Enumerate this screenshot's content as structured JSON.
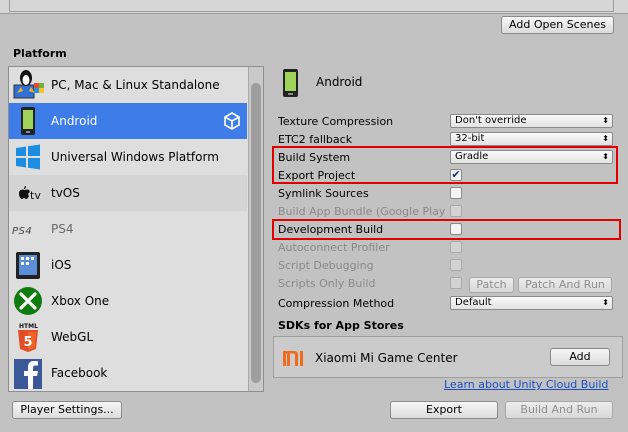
{
  "header": {
    "add_open_scenes": "Add Open Scenes"
  },
  "platform_header": "Platform",
  "platforms": [
    {
      "label": "PC, Mac & Linux Standalone"
    },
    {
      "label": "Android"
    },
    {
      "label": "Universal Windows Platform"
    },
    {
      "label": "tvOS"
    },
    {
      "label": "PS4"
    },
    {
      "label": "iOS"
    },
    {
      "label": "Xbox One"
    },
    {
      "label": "WebGL"
    },
    {
      "label": "Facebook"
    }
  ],
  "settings": {
    "title": "Android",
    "texture_compression": {
      "label": "Texture Compression",
      "value": "Don't override"
    },
    "etc2_fallback": {
      "label": "ETC2 fallback",
      "value": "32-bit"
    },
    "build_system": {
      "label": "Build System",
      "value": "Gradle"
    },
    "export_project": {
      "label": "Export Project",
      "checked": true
    },
    "symlink_sources": {
      "label": "Symlink Sources",
      "checked": false
    },
    "build_app_bundle": {
      "label": "Build App Bundle (Google Play"
    },
    "development_build": {
      "label": "Development Build",
      "checked": false
    },
    "autoconnect_profiler": {
      "label": "Autoconnect Profiler"
    },
    "script_debugging": {
      "label": "Script Debugging"
    },
    "scripts_only_build": {
      "label": "Scripts Only Build",
      "patch": "Patch",
      "patch_and_run": "Patch And Run"
    },
    "compression_method": {
      "label": "Compression Method",
      "value": "Default"
    },
    "sdks_header": "SDKs for App Stores",
    "sdk_item": {
      "label": "Xiaomi Mi Game Center",
      "add": "Add"
    },
    "cloud_build_link": "Learn about Unity Cloud Build"
  },
  "footer": {
    "player_settings": "Player Settings...",
    "export": "Export",
    "build_and_run": "Build And Run"
  },
  "colors": {
    "selected": "#3e7de7",
    "highlight": "#e00000",
    "link": "#1a4fbf",
    "mi_orange": "#f26b1d"
  }
}
